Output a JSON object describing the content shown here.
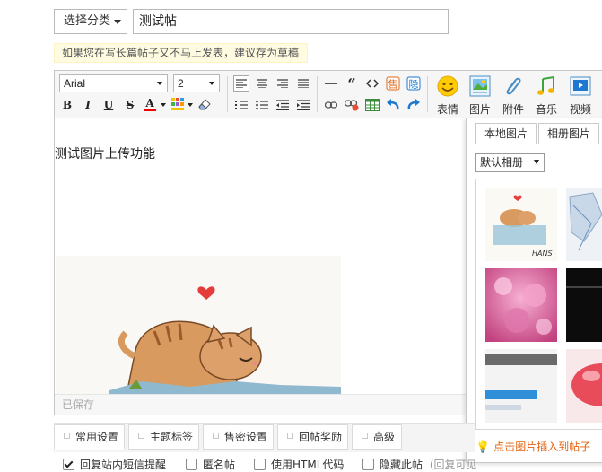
{
  "post": {
    "category_label": "选择分类",
    "title_value": "测试帖",
    "draft_tip": "如果您在写长篇帖子又不马上发表，建议存为草稿"
  },
  "toolbar": {
    "font_family": "Arial",
    "font_size": "2",
    "bold": "B",
    "italic": "I",
    "underline": "U",
    "strike": "S",
    "font_color": "A",
    "emoticon_label": "表情",
    "image_label": "图片",
    "attachment_label": "附件",
    "music_label": "音乐",
    "video_label": "视频",
    "accent_color": "#1e78d0"
  },
  "editor": {
    "content_text": "测试图片上传功能",
    "saved_status": "已保存"
  },
  "image_panel": {
    "tabs": [
      "本地图片",
      "相册图片"
    ],
    "selected_tab": "相册图片",
    "album_value": "默认相册",
    "insert_tip": "点击图片插入到帖子",
    "thumbnail_caption": "HANS"
  },
  "bottom": {
    "tabs": [
      "常用设置",
      "主题标签",
      "售密设置",
      "回帖奖励",
      "高级"
    ],
    "options": [
      {
        "label": "回复站内短信提醒",
        "checked": true
      },
      {
        "label": "匿名帖",
        "checked": false
      },
      {
        "label": "使用HTML代码",
        "checked": false
      },
      {
        "label": "隐藏此帖",
        "checked": false
      }
    ],
    "hide_note": "(回复可见"
  }
}
